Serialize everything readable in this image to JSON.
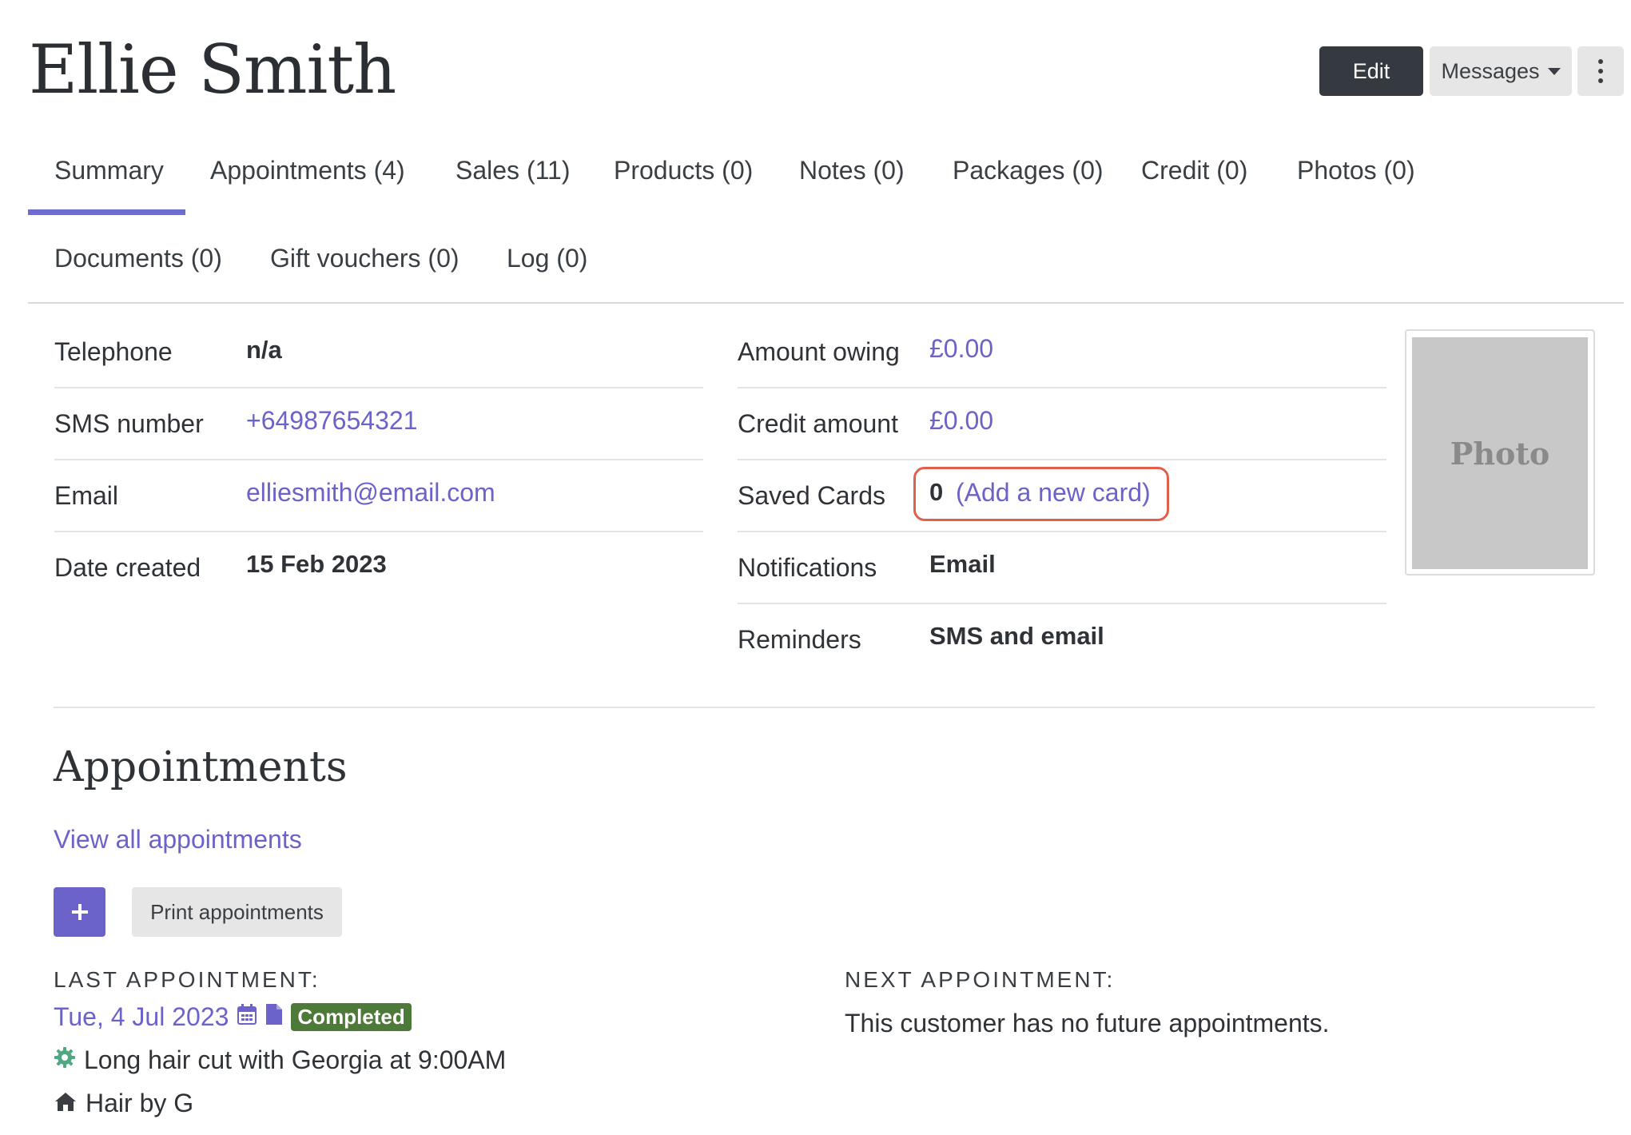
{
  "header": {
    "customer_name": "Ellie Smith",
    "edit_label": "Edit",
    "messages_label": "Messages"
  },
  "tabs": [
    {
      "label": "Summary",
      "active": true
    },
    {
      "label": "Appointments (4)"
    },
    {
      "label": "Sales (11)"
    },
    {
      "label": "Products (0)"
    },
    {
      "label": "Notes (0)"
    },
    {
      "label": "Packages (0)"
    },
    {
      "label": "Credit (0)"
    },
    {
      "label": "Photos (0)"
    },
    {
      "label": "Documents (0)"
    },
    {
      "label": "Gift vouchers (0)"
    },
    {
      "label": "Log (0)"
    }
  ],
  "details_left": [
    {
      "label": "Telephone",
      "value": "n/a"
    },
    {
      "label": "SMS number",
      "value": "+64987654321"
    },
    {
      "label": "Email",
      "value": "elliesmith@email.com"
    },
    {
      "label": "Date created",
      "value": "15 Feb 2023"
    }
  ],
  "details_right": [
    {
      "label": "Amount owing",
      "value": "£0.00"
    },
    {
      "label": "Credit amount",
      "value": "£0.00"
    },
    {
      "label": "Saved Cards",
      "value": "0",
      "link": "(Add a new card)"
    },
    {
      "label": "Notifications",
      "value": "Email"
    },
    {
      "label": "Reminders",
      "value": "SMS and email"
    }
  ],
  "photo": {
    "placeholder": "Photo"
  },
  "appointments": {
    "title": "Appointments",
    "view_all": "View all appointments",
    "print_label": "Print appointments",
    "last_heading": "LAST APPOINTMENT:",
    "last_date": "Tue, 4 Jul 2023",
    "last_status": "Completed",
    "last_service": "Long hair cut with Georgia at 9:00AM",
    "last_location": "Hair by G",
    "next_heading": "NEXT APPOINTMENT:",
    "next_text": "This customer has no future appointments."
  },
  "colors": {
    "accent": "#6b63c9",
    "dark_button": "#343a40",
    "status_completed": "#4d7a38",
    "highlight": "#e0604c",
    "service_icon": "#4fa882"
  }
}
